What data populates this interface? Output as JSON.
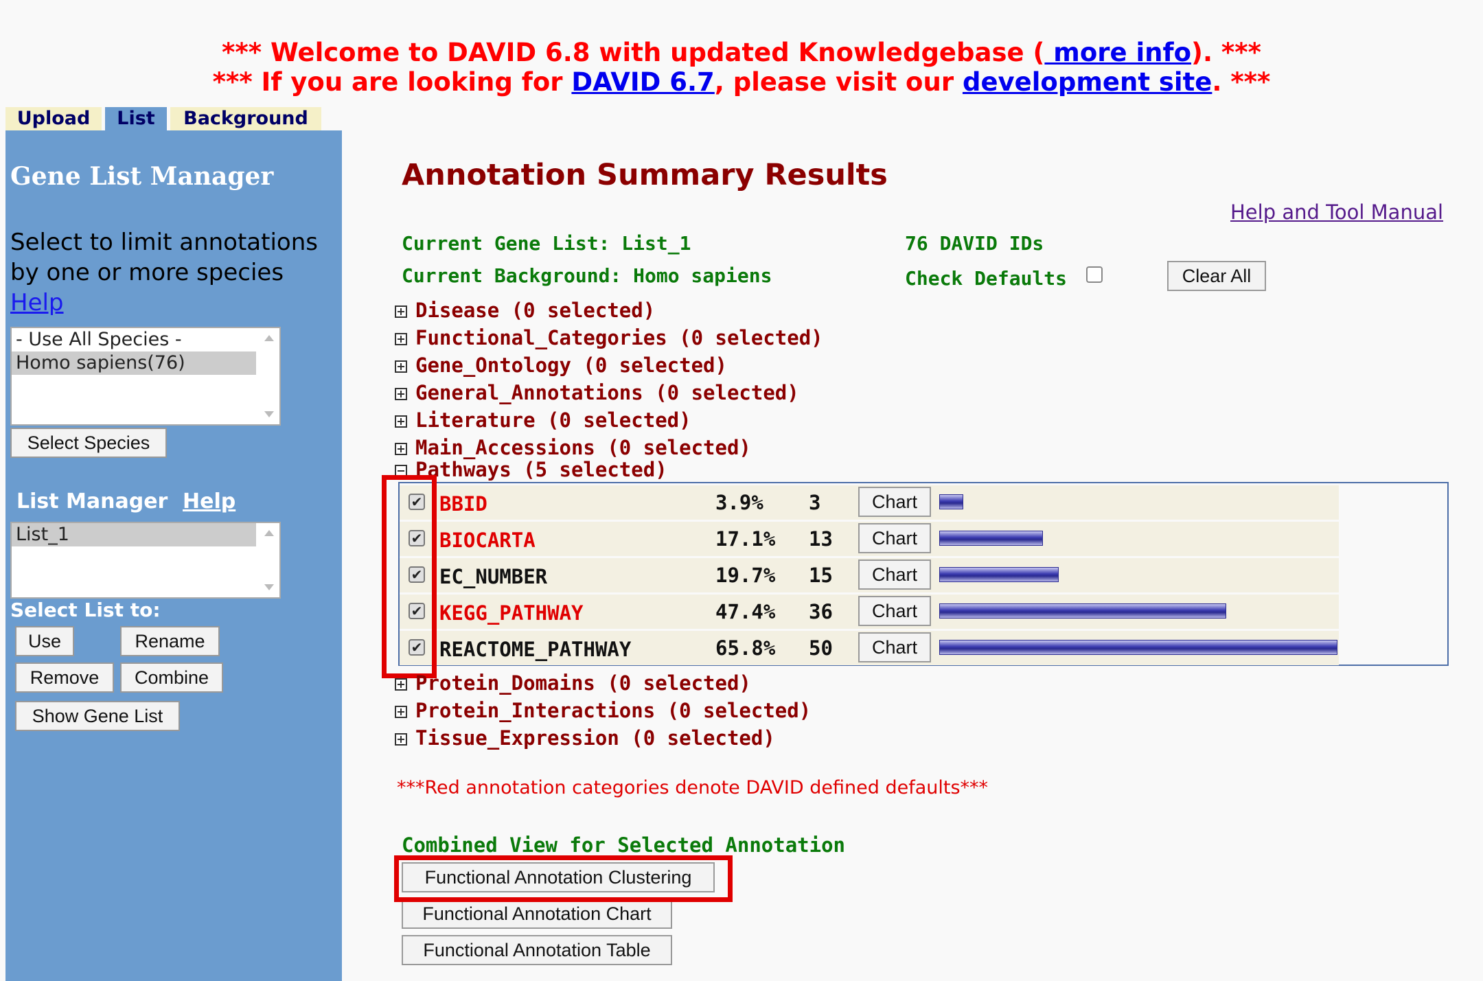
{
  "banner": {
    "line1_prefix": "*** Welcome to DAVID 6.8 with updated Knowledgebase (",
    "line1_link": " more info",
    "line1_suffix": "). ***",
    "line2_prefix": "*** If you are looking for ",
    "line2_link1": "DAVID 6.7",
    "line2_mid": ", please visit our ",
    "line2_link2": "development site",
    "line2_suffix": ". ***"
  },
  "tabs": [
    "Upload",
    "List",
    "Background"
  ],
  "sidebar": {
    "title": "Gene List Manager",
    "species_text_1": "Select to limit annotations",
    "species_text_2": "by one or more species",
    "help": "Help",
    "species_options": [
      "- Use All Species -",
      "Homo sapiens(76)"
    ],
    "select_species_button": "Select Species",
    "list_manager_label": "List Manager",
    "list_manager_help": "Help",
    "lists": [
      "List_1"
    ],
    "select_list_label": "Select List to:",
    "buttons": {
      "use": "Use",
      "rename": "Rename",
      "remove": "Remove",
      "combine": "Combine",
      "show_gene_list": "Show Gene List"
    }
  },
  "main": {
    "title": "Annotation Summary Results",
    "help_manual": "Help and Tool Manual",
    "current_gene_list": "Current Gene List: List_1",
    "current_background": "Current Background: Homo sapiens",
    "david_ids": "76 DAVID IDs",
    "check_defaults": "Check Defaults",
    "clear_all": "Clear All",
    "categories_top": [
      "Disease (0 selected)",
      "Functional_Categories (0 selected)",
      "Gene_Ontology (0 selected)",
      "General_Annotations (0 selected)",
      "Literature (0 selected)",
      "Main_Accessions (0 selected)"
    ],
    "pathways_header": "Pathways (5 selected)",
    "pathways": [
      {
        "name": "BBID",
        "percent": "3.9%",
        "count": "3",
        "chart": "Chart",
        "color": "#e00000",
        "fraction": 0.06
      },
      {
        "name": "BIOCARTA",
        "percent": "17.1%",
        "count": "13",
        "chart": "Chart",
        "color": "#e00000",
        "fraction": 0.26
      },
      {
        "name": "EC_NUMBER",
        "percent": "19.7%",
        "count": "15",
        "chart": "Chart",
        "color": "#111111",
        "fraction": 0.3
      },
      {
        "name": "KEGG_PATHWAY",
        "percent": "47.4%",
        "count": "36",
        "chart": "Chart",
        "color": "#e00000",
        "fraction": 0.72
      },
      {
        "name": "REACTOME_PATHWAY",
        "percent": "65.8%",
        "count": "50",
        "chart": "Chart",
        "color": "#111111",
        "fraction": 1.0
      }
    ],
    "categories_bottom": [
      "Protein_Domains (0 selected)",
      "Protein_Interactions (0 selected)",
      "Tissue_Expression (0 selected)"
    ],
    "note": "***Red annotation categories denote DAVID defined defaults***",
    "combined_view_label": "Combined View for Selected Annotation",
    "combined_buttons": [
      "Functional Annotation Clustering",
      "Functional Annotation Chart",
      "Functional Annotation Table"
    ]
  }
}
